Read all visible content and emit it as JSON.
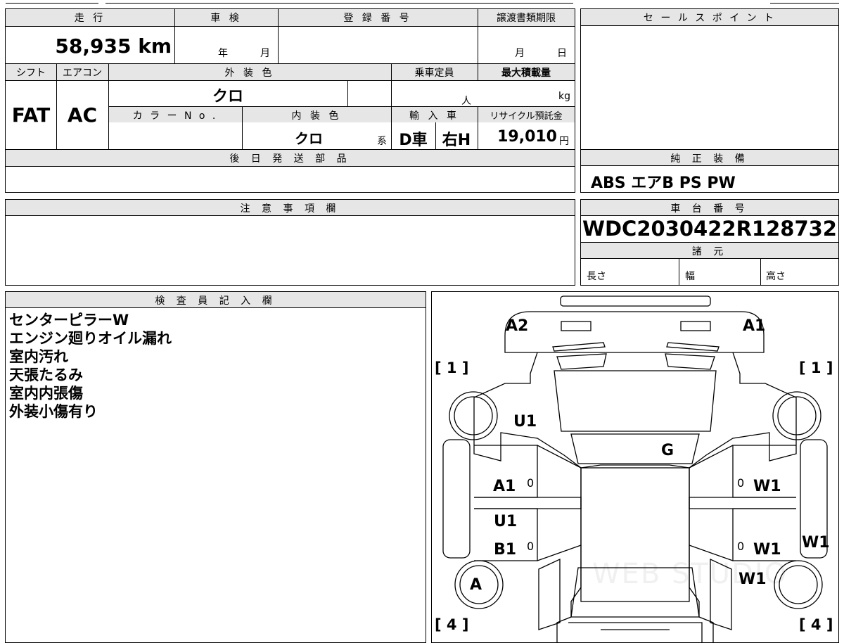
{
  "headers": {
    "mileage": "走 行",
    "inspection": "車 検",
    "registration": "登 録 番 号",
    "transfer_deadline": "譲渡書類期限",
    "sales_point": "セ ー ル ス ポ イ ン ト",
    "shift": "シフト",
    "aircon": "エアコン",
    "exterior_color": "外 装 色",
    "capacity": "乗車定員",
    "max_load": "最大積載量",
    "color_no": "カ ラ ー N o .",
    "interior_color": "内 装 色",
    "import": "輸 入 車",
    "recycle": "リサイクル預託金",
    "later_parts": "後 日 発 送 部 品",
    "genuine_equipment": "純 正 装 備",
    "notes": "注 意 事 項 欄",
    "chassis": "車 台 番 号",
    "specs": "諸 元",
    "inspector": "検 査 員 記 入 欄"
  },
  "values": {
    "mileage": "58,935 km",
    "inspection_year_unit": "年",
    "inspection_month_unit": "月",
    "deadline_month_unit": "月",
    "deadline_day_unit": "日",
    "shift": "FAT",
    "aircon": "AC",
    "exterior_color": "クロ",
    "capacity_unit": "人",
    "load_unit": "kg",
    "interior_color": "クロ",
    "interior_suffix": "系",
    "import_d": "D車",
    "import_h": "右H",
    "recycle_amount": "19,010",
    "recycle_unit": "円",
    "genuine_equipment": "ABS エアB PS PW",
    "chassis_number": "WDC2030422R128732",
    "spec_length": "長さ",
    "spec_width": "幅",
    "spec_height": "高さ"
  },
  "inspector_notes": [
    "センターピラーW",
    "エンジン廻りオイル漏れ",
    "室内汚れ",
    "天張たるみ",
    "室内内張傷",
    "外装小傷有り"
  ],
  "diagram": {
    "a2": "A2",
    "a1_top": "A1",
    "left_1": "[ 1 ]",
    "right_1": "[ 1 ]",
    "u1_top": "U1",
    "g": "G",
    "a1_left": "A1",
    "zero1": "0",
    "u1_left": "U1",
    "b1_left": "B1",
    "zero2": "0",
    "zero3": "0",
    "w1_r1": "W1",
    "zero4": "0",
    "w1_r2": "W1",
    "w1_side": "W1",
    "w1_r3": "W1",
    "a_circle": "A",
    "left_4": "[ 4 ]",
    "right_4": "[ 4 ]",
    "watermark": "WEB STUDIO"
  }
}
